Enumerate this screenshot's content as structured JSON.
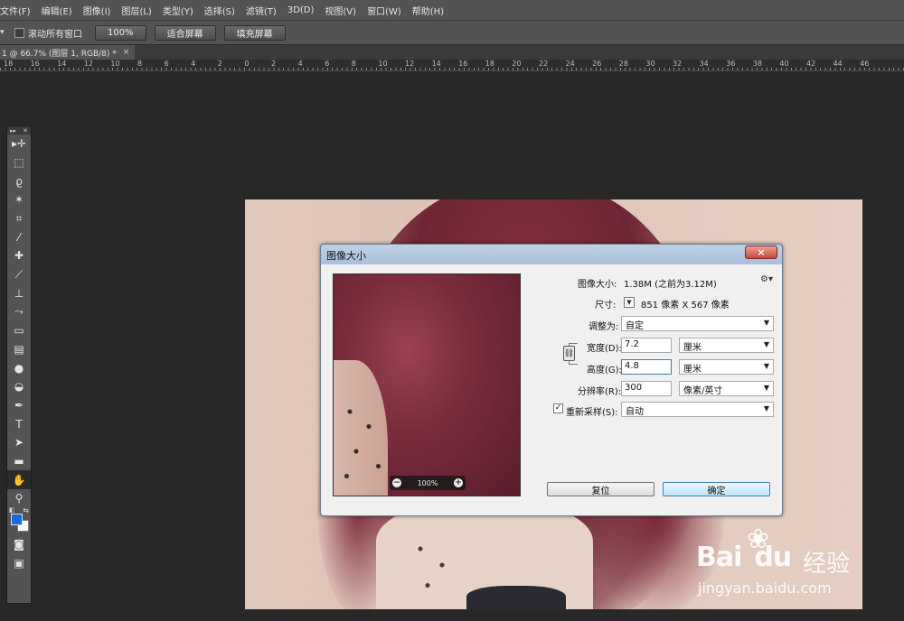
{
  "menu": [
    "文件(F)",
    "编辑(E)",
    "图像(I)",
    "图层(L)",
    "类型(Y)",
    "选择(S)",
    "滤镜(T)",
    "3D(D)",
    "视图(V)",
    "窗口(W)",
    "帮助(H)"
  ],
  "options": {
    "scroll_all_label": "滚动所有窗口",
    "zoom_100": "100%",
    "fit_screen": "适合屏幕",
    "fill_screen": "填充屏幕"
  },
  "document_tab": {
    "title": "1 @ 66.7% (图层 1, RGB/8) *",
    "close": "×"
  },
  "ruler_ticks": [
    "18",
    "16",
    "14",
    "12",
    "10",
    "8",
    "6",
    "4",
    "2",
    "0",
    "2",
    "4",
    "6",
    "8",
    "10",
    "12",
    "14",
    "16",
    "18",
    "20",
    "22",
    "24",
    "26",
    "28",
    "30",
    "32",
    "34",
    "36",
    "38",
    "40",
    "42",
    "44",
    "46"
  ],
  "toolbox": {
    "tools": [
      {
        "name": "move-tool-icon",
        "glyph": "▸✛"
      },
      {
        "name": "marquee-tool-icon",
        "glyph": "⬚"
      },
      {
        "name": "lasso-tool-icon",
        "glyph": "ϱ"
      },
      {
        "name": "magic-wand-icon",
        "glyph": "✶"
      },
      {
        "name": "crop-tool-icon",
        "glyph": "⌗"
      },
      {
        "name": "eyedropper-icon",
        "glyph": "⁄"
      },
      {
        "name": "healing-brush-icon",
        "glyph": "✚"
      },
      {
        "name": "brush-tool-icon",
        "glyph": "⟋"
      },
      {
        "name": "clone-stamp-icon",
        "glyph": "⊥"
      },
      {
        "name": "history-brush-icon",
        "glyph": "⤳"
      },
      {
        "name": "eraser-icon",
        "glyph": "▭"
      },
      {
        "name": "gradient-tool-icon",
        "glyph": "▤"
      },
      {
        "name": "blur-tool-icon",
        "glyph": "●"
      },
      {
        "name": "dodge-tool-icon",
        "glyph": "◒"
      },
      {
        "name": "pen-tool-icon",
        "glyph": "✒"
      },
      {
        "name": "type-tool-icon",
        "glyph": "T"
      },
      {
        "name": "path-selection-icon",
        "glyph": "➤"
      },
      {
        "name": "rectangle-tool-icon",
        "glyph": "▬"
      },
      {
        "name": "hand-tool-icon",
        "glyph": "✋"
      },
      {
        "name": "zoom-tool-icon",
        "glyph": "⚲"
      }
    ],
    "active_tool": "hand-tool-icon",
    "foreground_color": "#1a6bd8",
    "background_color": "#ffffff"
  },
  "dialog": {
    "title": "图像大小",
    "close": "×",
    "image_size_label": "图像大小:",
    "image_size_value": "1.38M (之前为3.12M)",
    "dimensions_label": "尺寸:",
    "dimensions_value": "851 像素  X  567 像素",
    "fit_to_label": "调整为:",
    "fit_to_value": "自定",
    "width_label": "宽度(D):",
    "width_value": "7.2",
    "width_unit": "厘米",
    "height_label": "高度(G):",
    "height_value": "4.8",
    "height_unit": "厘米",
    "resolution_label": "分辨率(R):",
    "resolution_value": "300",
    "resolution_unit": "像素/英寸",
    "resample_label": "重新采样(S):",
    "resample_checked": true,
    "resample_value": "自动",
    "preview_zoom": "100%",
    "reset_button": "复位",
    "ok_button": "确定"
  },
  "watermark": {
    "brand": "Bai",
    "brand_du": "du",
    "brand_cn": "经验",
    "url": "jingyan.baidu.com"
  }
}
